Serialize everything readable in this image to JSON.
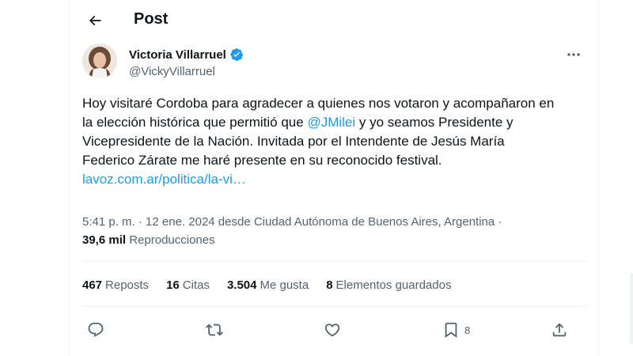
{
  "header": {
    "title": "Post",
    "back_icon": "arrow-left-icon"
  },
  "author": {
    "name": "Victoria Villarruel",
    "handle": "@VickyVillarruel",
    "verified_icon": "verified-badge-icon",
    "verified_color": "#1d9bf0"
  },
  "post": {
    "text_before_mention": "Hoy visitaré Cordoba para agradecer a quienes nos votaron y acompañaron en la elección histórica que permitió que ",
    "mention": "@JMilei",
    "text_after_mention": " y yo seamos Presidente y Vicepresidente de la Nación. Invitada por el Intendente de Jesús María Federico Zárate me haré presente en su reconocido festival. ",
    "link": "lavoz.com.ar/politica/la-vi…"
  },
  "meta": {
    "time": "5:41 p. m.",
    "sep1": " · ",
    "date": "12 ene. 2024",
    "location": " desde Ciudad Autónoma de Buenos Aires, Argentina",
    "sep2": " · ",
    "views_count": "39,6 mil",
    "views_label": " Reproducciones"
  },
  "stats": [
    {
      "num": "467",
      "label": "Reposts"
    },
    {
      "num": "16",
      "label": "Citas"
    },
    {
      "num": "3.504",
      "label": "Me gusta"
    },
    {
      "num": "8",
      "label": "Elementos guardados"
    }
  ],
  "actions": {
    "reply_icon": "reply-icon",
    "repost_icon": "repost-icon",
    "like_icon": "heart-icon",
    "bookmark_icon": "bookmark-icon",
    "bookmark_count": "8",
    "share_icon": "share-icon"
  },
  "colors": {
    "accent": "#1d9bf0",
    "text_primary": "#0f1419",
    "text_secondary": "#536471",
    "border": "#eff3f4"
  }
}
